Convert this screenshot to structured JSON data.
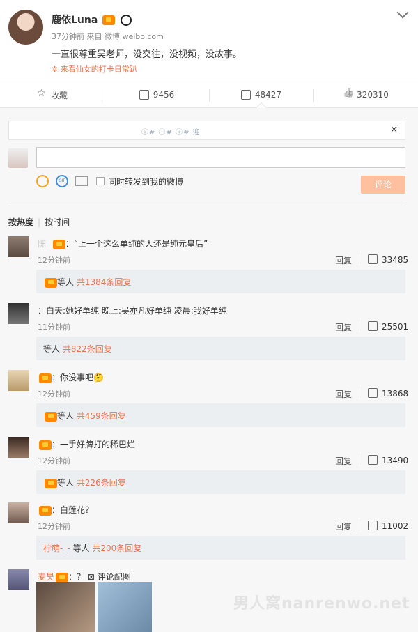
{
  "post": {
    "author": "鹿依Luna",
    "meta": "37分钟前 来自 微博 weibo.com",
    "text": "一直很尊重吴老师，没交往，没视频，没故事。",
    "topic": "✲ 来看仙女的打卡日常趴"
  },
  "actions": {
    "favorite": "收藏",
    "share": "9456",
    "comment": "48427",
    "like": "320310"
  },
  "notice": {
    "text": "ⓘ#  ⓘ#  ⓘ#   迎"
  },
  "composer": {
    "forward_label": "同时转发到我的微博",
    "submit": "评论"
  },
  "sort": {
    "hot": "按热度",
    "time": "按时间"
  },
  "comments": [
    {
      "name_blur": "陈 ",
      "text": "：“上一个这么单纯的人还是纯元皇后”",
      "time": "12分钟前",
      "reply": "回复",
      "likes": "33485",
      "sub_blur": "  ",
      "sub_text": "等人",
      "sub_count": "共1384条回复"
    },
    {
      "name_blur": "  ",
      "text": "：白天:她好单纯 晚上:吴亦凡好单纯 凌晨:我好单纯",
      "time": "11分钟前",
      "reply": "回复",
      "likes": "25501",
      "sub_blur": "  ",
      "sub_text": "等人",
      "sub_count": "共822条回复"
    },
    {
      "name_blur": "  ",
      "text": "：你没事吧🤔",
      "time": "12分钟前",
      "reply": "回复",
      "likes": "13868",
      "sub_blur": "  ",
      "sub_text": "等人",
      "sub_count": "共459条回复"
    },
    {
      "name_blur": "  ",
      "text": "：一手好牌打的稀巴烂",
      "time": "12分钟前",
      "reply": "回复",
      "likes": "13490",
      "sub_blur": "  ",
      "sub_text": "等人",
      "sub_count": "共226条回复"
    },
    {
      "name_blur": "  ",
      "text": "：白莲花？",
      "time": "12分钟前",
      "reply": "回复",
      "likes": "11002",
      "sub_blur": "柠萌-_-",
      "sub_text": "等人",
      "sub_count": "共200条回复"
    },
    {
      "name_blur": " 麦昊",
      "text": "：？  ⊠ 评论配图"
    }
  ],
  "watermark": "男人窝nanrenwo.net"
}
